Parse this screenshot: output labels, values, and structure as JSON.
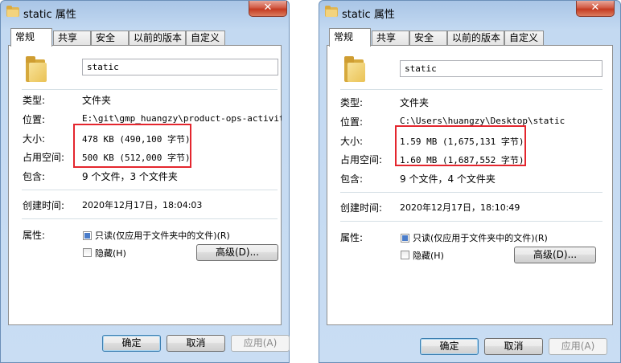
{
  "left": {
    "title": "static 属性",
    "close": "✕",
    "tabs": [
      "常规",
      "共享",
      "安全",
      "以前的版本",
      "自定义"
    ],
    "name_value": "static",
    "type_label": "类型:",
    "type_value": "文件夹",
    "location_label": "位置:",
    "location_value": "E:\\git\\gmp_huangzy\\product-ops-activity\\d",
    "size_label": "大小:",
    "size_value": "478 KB (490,100 字节)",
    "disk_label": "占用空间:",
    "disk_value": "500 KB (512,000 字节)",
    "contains_label": "包含:",
    "contains_value": "9 个文件，3 个文件夹",
    "created_label": "创建时间:",
    "created_value": "2020年12月17日，18:04:03",
    "attr_label": "属性:",
    "readonly_label": "只读(仅应用于文件夹中的文件)(R)",
    "hidden_label": "隐藏(H)",
    "advanced_label": "高级(D)...",
    "ok_label": "确定",
    "cancel_label": "取消",
    "apply_label": "应用(A)"
  },
  "right": {
    "title": "static 属性",
    "close": "✕",
    "tabs": [
      "常规",
      "共享",
      "安全",
      "以前的版本",
      "自定义"
    ],
    "name_value": "static",
    "type_label": "类型:",
    "type_value": "文件夹",
    "location_label": "位置:",
    "location_value": "C:\\Users\\huangzy\\Desktop\\static",
    "size_label": "大小:",
    "size_value": "1.59 MB (1,675,131 字节)",
    "disk_label": "占用空间:",
    "disk_value": "1.60 MB (1,687,552 字节)",
    "contains_label": "包含:",
    "contains_value": "9 个文件，4 个文件夹",
    "created_label": "创建时间:",
    "created_value": "2020年12月17日，18:10:49",
    "attr_label": "属性:",
    "readonly_label": "只读(仅应用于文件夹中的文件)(R)",
    "hidden_label": "隐藏(H)",
    "advanced_label": "高级(D)...",
    "ok_label": "确定",
    "cancel_label": "取消",
    "apply_label": "应用(A)"
  },
  "colors": {
    "highlight": "#e4262e",
    "window_frame": "#c3d9f1",
    "checkbox_fill": "#4a7cc9"
  }
}
